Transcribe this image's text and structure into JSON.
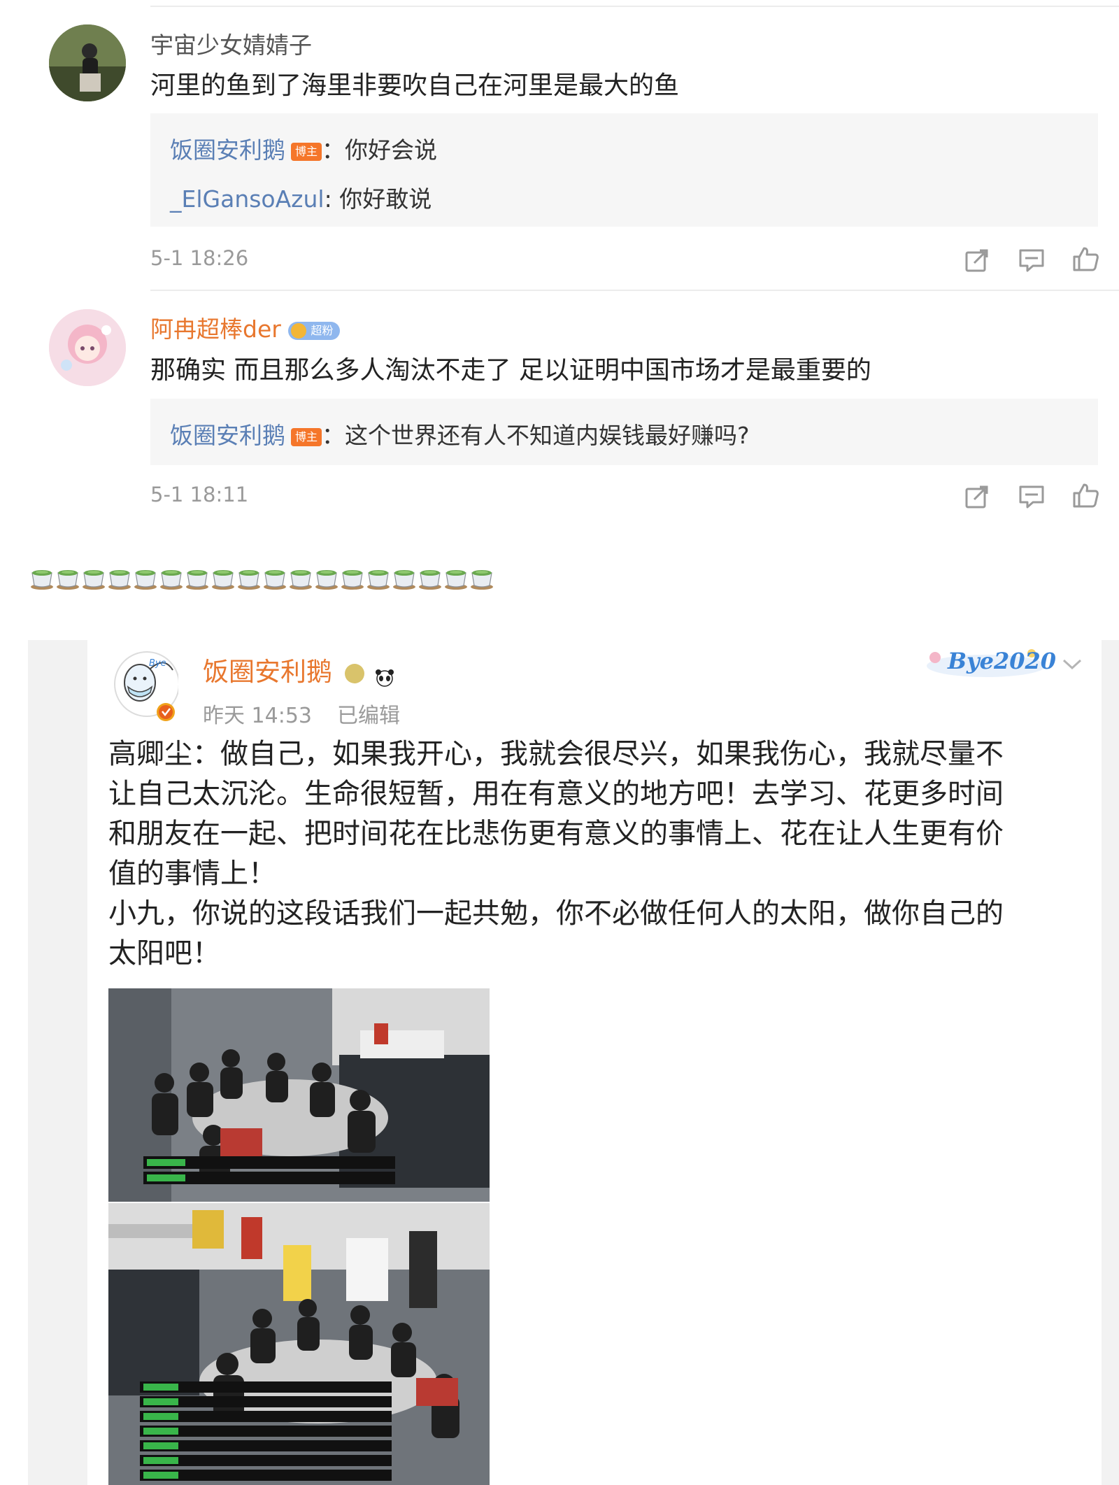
{
  "comments": [
    {
      "username": "宇宙少女婧婧子",
      "text": "河里的鱼到了海里非要吹自己在河里是最大的鱼",
      "replies": [
        {
          "name": "饭圈安利鹅",
          "badge": "博主",
          "text": "：你好会说"
        },
        {
          "name": "_ElGansoAzul",
          "badge": "",
          "text": ": 你好敢说"
        }
      ],
      "time": "5-1 18:26"
    },
    {
      "username": "阿冉超棒der",
      "badge": "超粉",
      "text": "那确实 而且那么多人淘汰不走了 足以证明中国市场才是最重要的",
      "replies": [
        {
          "name": "饭圈安利鹅",
          "badge": "博主",
          "text": "：这个世界还有人不知道内娱钱最好赚吗?"
        }
      ],
      "time": "5-1 18:11"
    }
  ],
  "post": {
    "author": "饭圈安利鹅",
    "time": "昨天 14:53",
    "edited": "已编辑",
    "decoration": "Bye2020",
    "body": "高卿尘：做自己，如果我开心，我就会很尽兴，如果我伤心，我就尽量不\n让自己太沉沦。生命很短暂，用在有意义的地方吧！去学习、花更多时间\n和朋友在一起、把时间花在比悲伤更有意义的事情上、花在让人生更有价\n值的事情上！\n小九，你说的这段话我们一起共勉，你不必做任何人的太阳，做你自己的\n太阳吧！"
  },
  "colors": {
    "link_blue": "#5a7fb5",
    "orange": "#e8772e",
    "gray_text": "#9a9a9a",
    "badge_orange": "#f5762a"
  },
  "icons": [
    "share-icon",
    "comment-icon",
    "like-icon",
    "chevron-down-icon",
    "verified-icon"
  ]
}
